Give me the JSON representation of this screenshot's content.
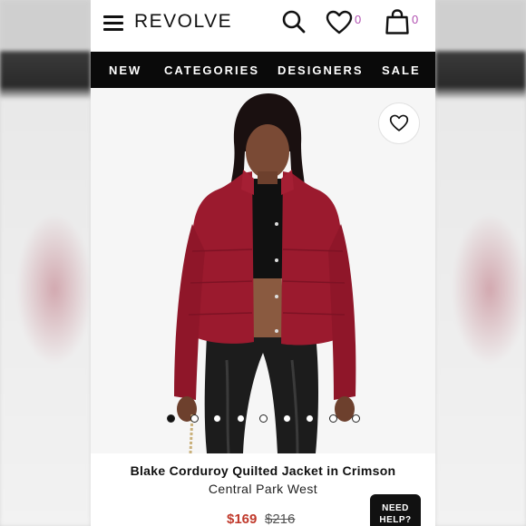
{
  "header": {
    "logo": "REVOLVE",
    "wishlist_count": "0",
    "bag_count": "0"
  },
  "nav": {
    "items": [
      {
        "label": "NEW"
      },
      {
        "label": "CATEGORIES"
      },
      {
        "label": "DESIGNERS"
      },
      {
        "label": "SALE"
      }
    ]
  },
  "product": {
    "title": "Blake Corduroy Quilted Jacket in Crimson",
    "brand": "Central Park West",
    "price_sale": "$169",
    "price_original": "$216",
    "image_count": 9,
    "active_image": 1,
    "jacket_color": "#9b1a2e"
  },
  "help": {
    "label_line1": "NEED",
    "label_line2": "HELP?"
  },
  "colors": {
    "accent": "#b04fb0",
    "sale": "#c0392b",
    "nav_bg": "#0a0a0a"
  }
}
